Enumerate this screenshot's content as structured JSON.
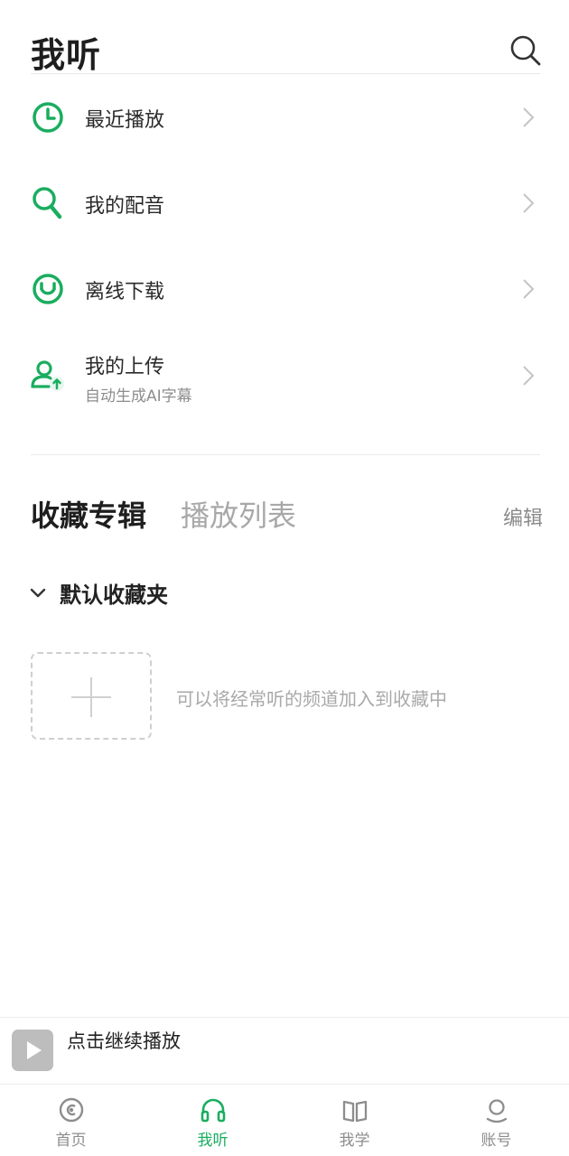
{
  "header": {
    "title": "我听"
  },
  "menu": [
    {
      "label": "最近播放",
      "sublabel": ""
    },
    {
      "label": "我的配音",
      "sublabel": ""
    },
    {
      "label": "离线下载",
      "sublabel": ""
    },
    {
      "label": "我的上传",
      "sublabel": "自动生成AI字幕"
    }
  ],
  "tabs": {
    "active": "收藏专辑",
    "inactive": "播放列表",
    "edit": "编辑"
  },
  "folder": {
    "name": "默认收藏夹",
    "empty_hint": "可以将经常听的频道加入到收藏中"
  },
  "player": {
    "prompt": "点击继续播放"
  },
  "bottom_nav": [
    {
      "label": "首页",
      "icon": "home-disc-icon"
    },
    {
      "label": "我听",
      "icon": "headphones-icon"
    },
    {
      "label": "我学",
      "icon": "book-icon"
    },
    {
      "label": "账号",
      "icon": "account-icon"
    }
  ],
  "colors": {
    "accent": "#1aad5f",
    "text_primary": "#222222",
    "text_secondary": "#8d8d8d",
    "divider": "#e8e8e8"
  }
}
